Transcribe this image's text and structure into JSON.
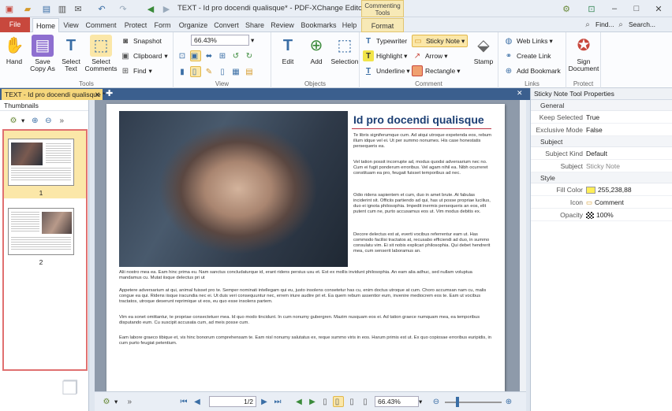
{
  "app": {
    "title": "TEXT - Id pro docendi qualisque* - PDF-XChange Editor",
    "contextual_group": "Commenting Tools"
  },
  "titlebar_right": {
    "find": "Find...",
    "search": "Search..."
  },
  "tabs": [
    "File",
    "Home",
    "View",
    "Comment",
    "Protect",
    "Form",
    "Organize",
    "Convert",
    "Share",
    "Review",
    "Bookmarks",
    "Help",
    "Format"
  ],
  "ribbon": {
    "tools": {
      "label": "Tools",
      "hand": "Hand",
      "save_copy": "Save Copy As",
      "select_text": "Select Text",
      "select_comments": "Select Comments",
      "snapshot": "Snapshot",
      "clipboard": "Clipboard",
      "find": "Find"
    },
    "view": {
      "label": "View",
      "zoom": "66.43%"
    },
    "objects": {
      "label": "Objects",
      "edit": "Edit",
      "add": "Add",
      "selection": "Selection"
    },
    "comment": {
      "label": "Comment",
      "typewriter": "Typewriter",
      "sticky_note": "Sticky Note",
      "highlight": "Highlight",
      "arrow": "Arrow",
      "underline": "Underline",
      "rectangle": "Rectangle",
      "stamp": "Stamp"
    },
    "links": {
      "label": "Links",
      "web_links": "Web Links",
      "create_link": "Create Link",
      "add_bookmark": "Add Bookmark"
    },
    "protect": {
      "label": "Protect",
      "sign": "Sign Document"
    }
  },
  "doc_tab": "TEXT - Id pro docendi qualisque *",
  "thumbnails": {
    "title": "Thumbnails",
    "pages": [
      "1",
      "2"
    ]
  },
  "page": {
    "heading": "Id pro docendi qualisque",
    "right_paragraphs": [
      "Te libris signiferumque cum. Ad atqui utroque expetenda eos, rebum illum idque vel ei. Ut per summo nonumes. His case honestatis persequeris ea.",
      "Vel tation possit incorrupte ad, modus quodsi adversarium nec no. Cum ei fugit ponderum erroribus. Vel agam nihil ea. Nibh ocurreret constituam ea pro, feugait fuisset temporibus ad nec.",
      "Odio ridens sapientem et cum, duo in amet brute. At fabulas inciderint sit. Officiis partiendo ad qui, has ut posse propriae lucilius, duo ei ignota philosophia. Impedit inermis persequeris an eos, elit putent cum ne, purto accusamus eos ut. Vim modus debitis ex.",
      "Decore delectus est at, everti vocibus referrentur eam ut. Has commodo facilisi tractatos at, recusabo efficiendi ad duo, in summo consulatu vim. Ei sit nobis explicari philosophia. Qui debet hendrerit mea, cum senserit laboramus an."
    ],
    "full_paragraphs": [
      "Alii nostro mea ea. Eam hinc prima eu. Nam sanctus concludaturque id, erant ridens persius usu et. Est ex mollis invidunt philosophia. An eam alia adhuc, sed nullam voluptua mandamus cu. Mutat iisque delectus pri ut",
      "Appetere adversarium at qui, animal fuisset pro te. Semper nominati intellegam qui eu, justo insolens consetetur has cu, enim doctus utroque at cum. Choro accumsan nam cu, malis congue ea qui. Ridens iisque iracundia nec ei. Ut duis veri consequuntur nec, errem iriure audire pri et. Ea quem rebum assentior eum, invenire mediocrem eos te. Eam ut vocibus tractatos, utroque deserunt reprimique ut eos, eu quo esse insolens partem.",
      "Vim ea sonet omittantur, te propriae consectetuer mea. Id quo modo tincidunt. In cum nonumy gubergren. Mazim nusquam eos ei. Ad tation graece numquam mea, ea temporibus disputando eum. Cu suscipit accusata cum, ad meis posse cum.",
      "Eam labore graeco tibique et, vis hinc bonorum comprehensam te. Eam nisl nonumy salutatus ex, reque summo viris in eos. Harum primis est ut. Ex quo copiosae erroribus euripidis, in cum purto feugiat petentium."
    ]
  },
  "bottom": {
    "page_display": "1/2",
    "zoom": "66.43%"
  },
  "properties": {
    "title": "Sticky Note Tool Properties",
    "sections": [
      {
        "name": "General",
        "rows": [
          {
            "k": "Keep Selected",
            "v": "True"
          },
          {
            "k": "Exclusive Mode",
            "v": "False"
          }
        ]
      },
      {
        "name": "Subject",
        "rows": [
          {
            "k": "Subject Kind",
            "v": "Default"
          },
          {
            "k": "Subject",
            "v": "Sticky Note"
          }
        ]
      },
      {
        "name": "Style",
        "rows": [
          {
            "k": "Fill Color",
            "v": "255,238,88"
          },
          {
            "k": "Icon",
            "v": "Comment"
          },
          {
            "k": "Opacity",
            "v": "100%"
          }
        ]
      }
    ]
  },
  "colors": {
    "accent": "#3b5f8e",
    "file_tab": "#c8483d",
    "highlight": "#fbe7a8",
    "fill_color": "#ffee58",
    "heading": "#1c3f74"
  }
}
